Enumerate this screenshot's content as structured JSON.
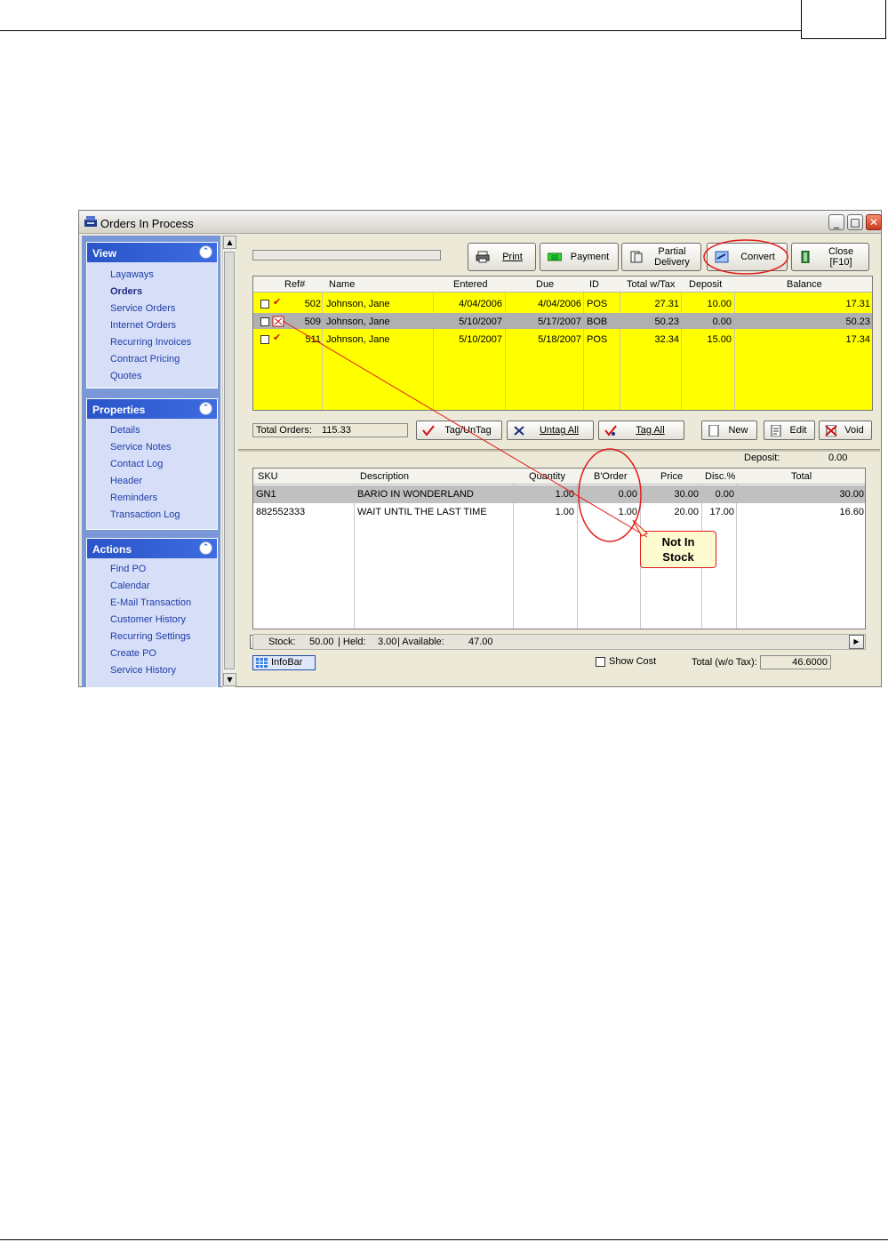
{
  "window": {
    "title": "Orders In Process",
    "controls": [
      "_",
      "□",
      "✕"
    ]
  },
  "sidebar": {
    "view": {
      "title": "View",
      "items": [
        "Layaways",
        "Orders",
        "Service Orders",
        "Internet Orders",
        "Recurring Invoices",
        "Contract Pricing",
        "Quotes"
      ]
    },
    "properties": {
      "title": "Properties",
      "items": [
        "Details",
        "Service Notes",
        "Contact Log",
        "Header",
        "Reminders",
        "Transaction Log"
      ]
    },
    "actions": {
      "title": "Actions",
      "items": [
        "Find PO",
        "Calendar",
        "E-Mail Transaction",
        "Customer History",
        "Recurring Settings",
        "Create PO",
        "Service History"
      ]
    }
  },
  "toolbar": {
    "print": "Print",
    "payment": "Payment",
    "partial_delivery": [
      "Partial",
      "Delivery"
    ],
    "convert": "Convert",
    "close": [
      "Close",
      "[F10]"
    ]
  },
  "orders": {
    "columns": [
      "Ref#",
      "Name",
      "Entered",
      "Due",
      "ID",
      "Total w/Tax",
      "Deposit",
      "Balance"
    ],
    "rows": [
      {
        "ref": "502",
        "name": "Johnson, Jane",
        "entered": "4/04/2006",
        "due": "4/04/2006",
        "id": "POS",
        "total": "27.31",
        "deposit": "10.00",
        "balance": "17.31"
      },
      {
        "ref": "509",
        "name": "Johnson, Jane",
        "entered": "5/10/2007",
        "due": "5/17/2007",
        "id": "BOB",
        "total": "50.23",
        "deposit": "0.00",
        "balance": "50.23"
      },
      {
        "ref": "511",
        "name": "Johnson, Jane",
        "entered": "5/10/2007",
        "due": "5/18/2007",
        "id": "POS",
        "total": "32.34",
        "deposit": "15.00",
        "balance": "17.34"
      }
    ],
    "row_colors": {
      "normal": "#ffff00",
      "selected": "#b0b0b0"
    }
  },
  "actions_bar": {
    "total_orders_label": "Total Orders:",
    "total_orders_value": "115.33",
    "tag_untag": "Tag/UnTag",
    "untag_all": "Untag All",
    "tag_all": "Tag All",
    "new": "New",
    "edit": "Edit",
    "void": "Void"
  },
  "details": {
    "deposit_label": "Deposit:",
    "deposit_value": "0.00",
    "columns": [
      "SKU",
      "Description",
      "Quantity",
      "B'Order",
      "Price",
      "Disc.%",
      "Total"
    ],
    "rows": [
      {
        "sku": "GN1",
        "desc": "BARIO IN WONDERLAND",
        "qty": "1.00",
        "border": "0.00",
        "price": "30.00",
        "disc": "0.00",
        "total": "30.00"
      },
      {
        "sku": "882552333",
        "desc": "WAIT UNTIL THE LAST TIME",
        "qty": "1.00",
        "border": "1.00",
        "price": "20.00",
        "disc": "17.00",
        "total": "16.60"
      }
    ],
    "stock_label": "Stock:",
    "stock_value": "50.00",
    "held_label": "| Held:",
    "held_value": "3.00",
    "available_label": "| Available:",
    "available_value": "47.00"
  },
  "footer": {
    "infobar": "InfoBar",
    "show_cost": "Show Cost",
    "total_label": "Total (w/o Tax):",
    "total_value": "46.6000"
  },
  "callout": [
    "Not In",
    "Stock"
  ],
  "colors": {
    "accent_red": "#e21a1a",
    "sidebar_head": "#2a55c8",
    "sidebar_link": "#1e3ca8"
  }
}
